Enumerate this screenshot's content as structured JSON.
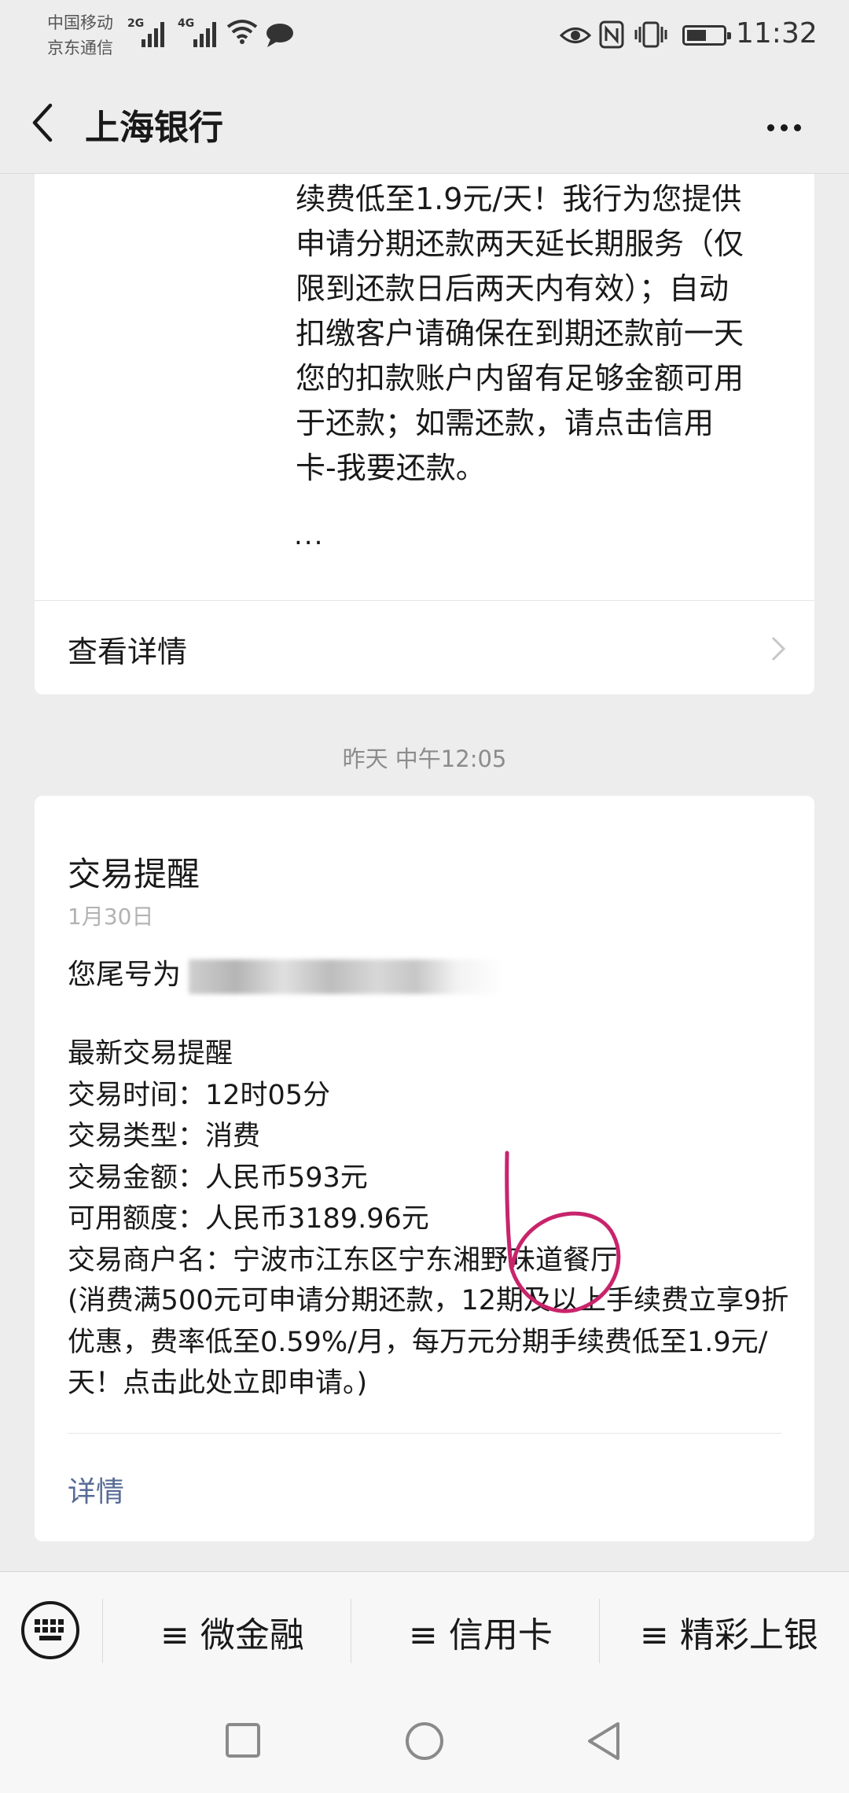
{
  "status_bar": {
    "carrier1": "中国移动",
    "carrier2": "京东通信",
    "net1": "2G",
    "net2": "4G",
    "time": "11:32",
    "battery_level": 0.55,
    "icons": [
      "signal-icon",
      "signal-icon",
      "wifi-icon",
      "chat-icon",
      "eye-icon",
      "nfc-icon",
      "vibrate-icon",
      "battery-icon"
    ]
  },
  "header": {
    "title": "上海银行",
    "back_icon": "chevron-left-icon",
    "more_icon": "more-dots-icon"
  },
  "message1": {
    "body_lines": [
      "续费低至1.9元/天！我行为您提供",
      "申请分期还款两天延长期服务（仅",
      "限到还款日后两天内有效）；自动",
      "扣缴客户请确保在到期还款前一天",
      "您的扣款账户内留有足够金额可用",
      "于还款；如需还款，请点击信用",
      "卡-我要还款。"
    ],
    "ellipsis": "...",
    "detail_label": "查看详情"
  },
  "timestamp": "昨天 中午12:05",
  "message2": {
    "title": "交易提醒",
    "date": "1月30日",
    "intro": "您尾号为",
    "lines": [
      "最新交易提醒",
      "交易时间：12时05分",
      "交易类型：消费",
      "交易金额：人民币593元",
      "可用额度：人民币3189.96元",
      "交易商户名：宁波市江东区宁东湘野味道餐厅"
    ],
    "promo": "(消费满500元可申请分期还款，12期及以上手续费立享9折优惠，费率低至0.59%/月，每万元分期手续费低至1.9元/天！点击此处立即申请。)",
    "link": "详情"
  },
  "menu": {
    "keyboard_icon": "keyboard-icon",
    "items": [
      "≡ 微金融",
      "≡ 信用卡",
      "≡ 精彩上银"
    ]
  },
  "nav": [
    "square-recent-icon",
    "circle-home-icon",
    "triangle-back-icon"
  ],
  "annotation_color": "#c8246b"
}
